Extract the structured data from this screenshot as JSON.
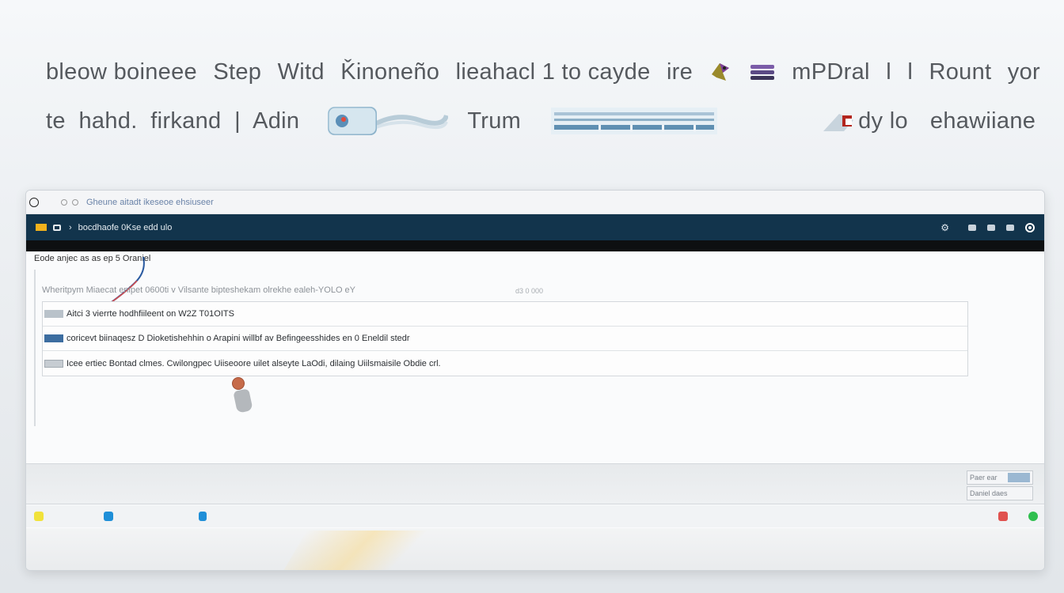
{
  "heading": {
    "line1": [
      "bleow boineee",
      "Step",
      "Witd",
      "Ǩinoneño",
      "lieahacl 1 to cayde",
      "ire",
      "",
      "",
      "mPDral",
      "l",
      "l",
      "Rount",
      "yor"
    ],
    "line2_a": "te  hahd.  firkand  |  Adin",
    "line2_b": "Trum",
    "line2_c": "dy  lo",
    "line2_d": "ehawiiane"
  },
  "window": {
    "title": "Gheune aitadt ikeseoe ehsiuseer",
    "nav_path": "bocdhaofe 0Kse edd ulo",
    "nav_right_text": "°",
    "breadcrumb": "Eode anjec as as ep 5 Oraniel",
    "hint": "Wheritpym  Miaecat  enipet 0600ti v  Vilsante bipteshekam  olrekhe ealeh-YOLO eY",
    "hint_right": "d3 0 000",
    "items": [
      "Aitci 3 vierrte  hodhfiileent on W2Z T01OITS",
      "coricevt biinaqesz D Dioketishehhin o Arapini willbf av Befingeesshides en 0 Eneldil stedr",
      "Icee ertiec  Bontad clmes.  Cwilongpec Uiiseoore uilet alseyte LaOdi,  dilaing Uiilsmaisile Obdie crl."
    ],
    "mini_box_1": "Paer ear",
    "mini_box_2": "Daniel daes"
  },
  "colors": {
    "nav_bg": "#12344c",
    "logo": "#f2b21c",
    "status_yellow": "#f1e23b",
    "status_blue": "#1f8fd8",
    "status_red": "#e0524f",
    "status_green": "#2fbf4f"
  },
  "icons": [
    "bird-icon",
    "stack-icon",
    "screen-icon",
    "wave-icon",
    "bars-icon",
    "grid-icon",
    "flag-icon"
  ]
}
